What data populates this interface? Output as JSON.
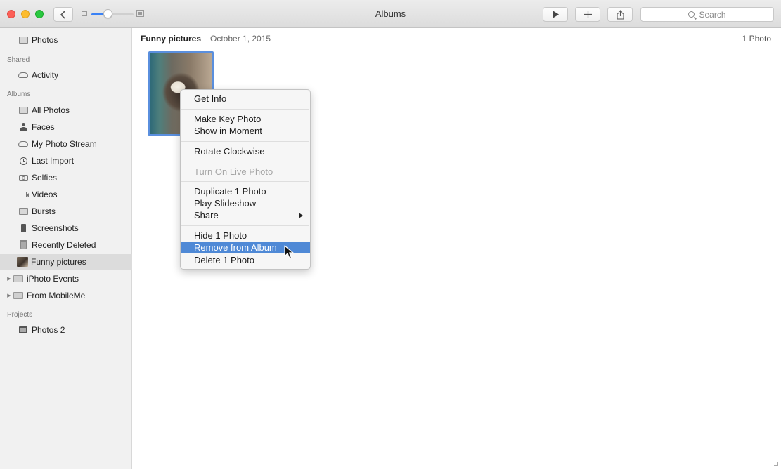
{
  "window": {
    "title": "Albums"
  },
  "search": {
    "placeholder": "Search"
  },
  "sidebar": {
    "top_item": "Photos",
    "sections": {
      "shared": "Shared",
      "albums": "Albums",
      "projects": "Projects"
    },
    "shared_items": [
      "Activity"
    ],
    "album_items": [
      "All Photos",
      "Faces",
      "My Photo Stream",
      "Last Import",
      "Selfies",
      "Videos",
      "Bursts",
      "Screenshots",
      "Recently Deleted",
      "Funny pictures",
      "iPhoto Events",
      "From MobileMe"
    ],
    "project_items": [
      "Photos 2"
    ],
    "selected": "Funny pictures"
  },
  "main": {
    "album_name": "Funny pictures",
    "album_date": "October 1, 2015",
    "photo_count": "1 Photo"
  },
  "context_menu": {
    "items": [
      "Get Info",
      "Make Key Photo",
      "Show in Moment",
      "Rotate Clockwise",
      "Turn On Live Photo",
      "Duplicate 1 Photo",
      "Play Slideshow",
      "Share",
      "Hide 1 Photo",
      "Remove from Album",
      "Delete 1 Photo"
    ],
    "disabled": "Turn On Live Photo",
    "highlighted": "Remove from Album"
  },
  "colors": {
    "accent": "#4f89d6",
    "selection_border": "#5a8fde",
    "sidebar_bg": "#f1f1f1"
  }
}
